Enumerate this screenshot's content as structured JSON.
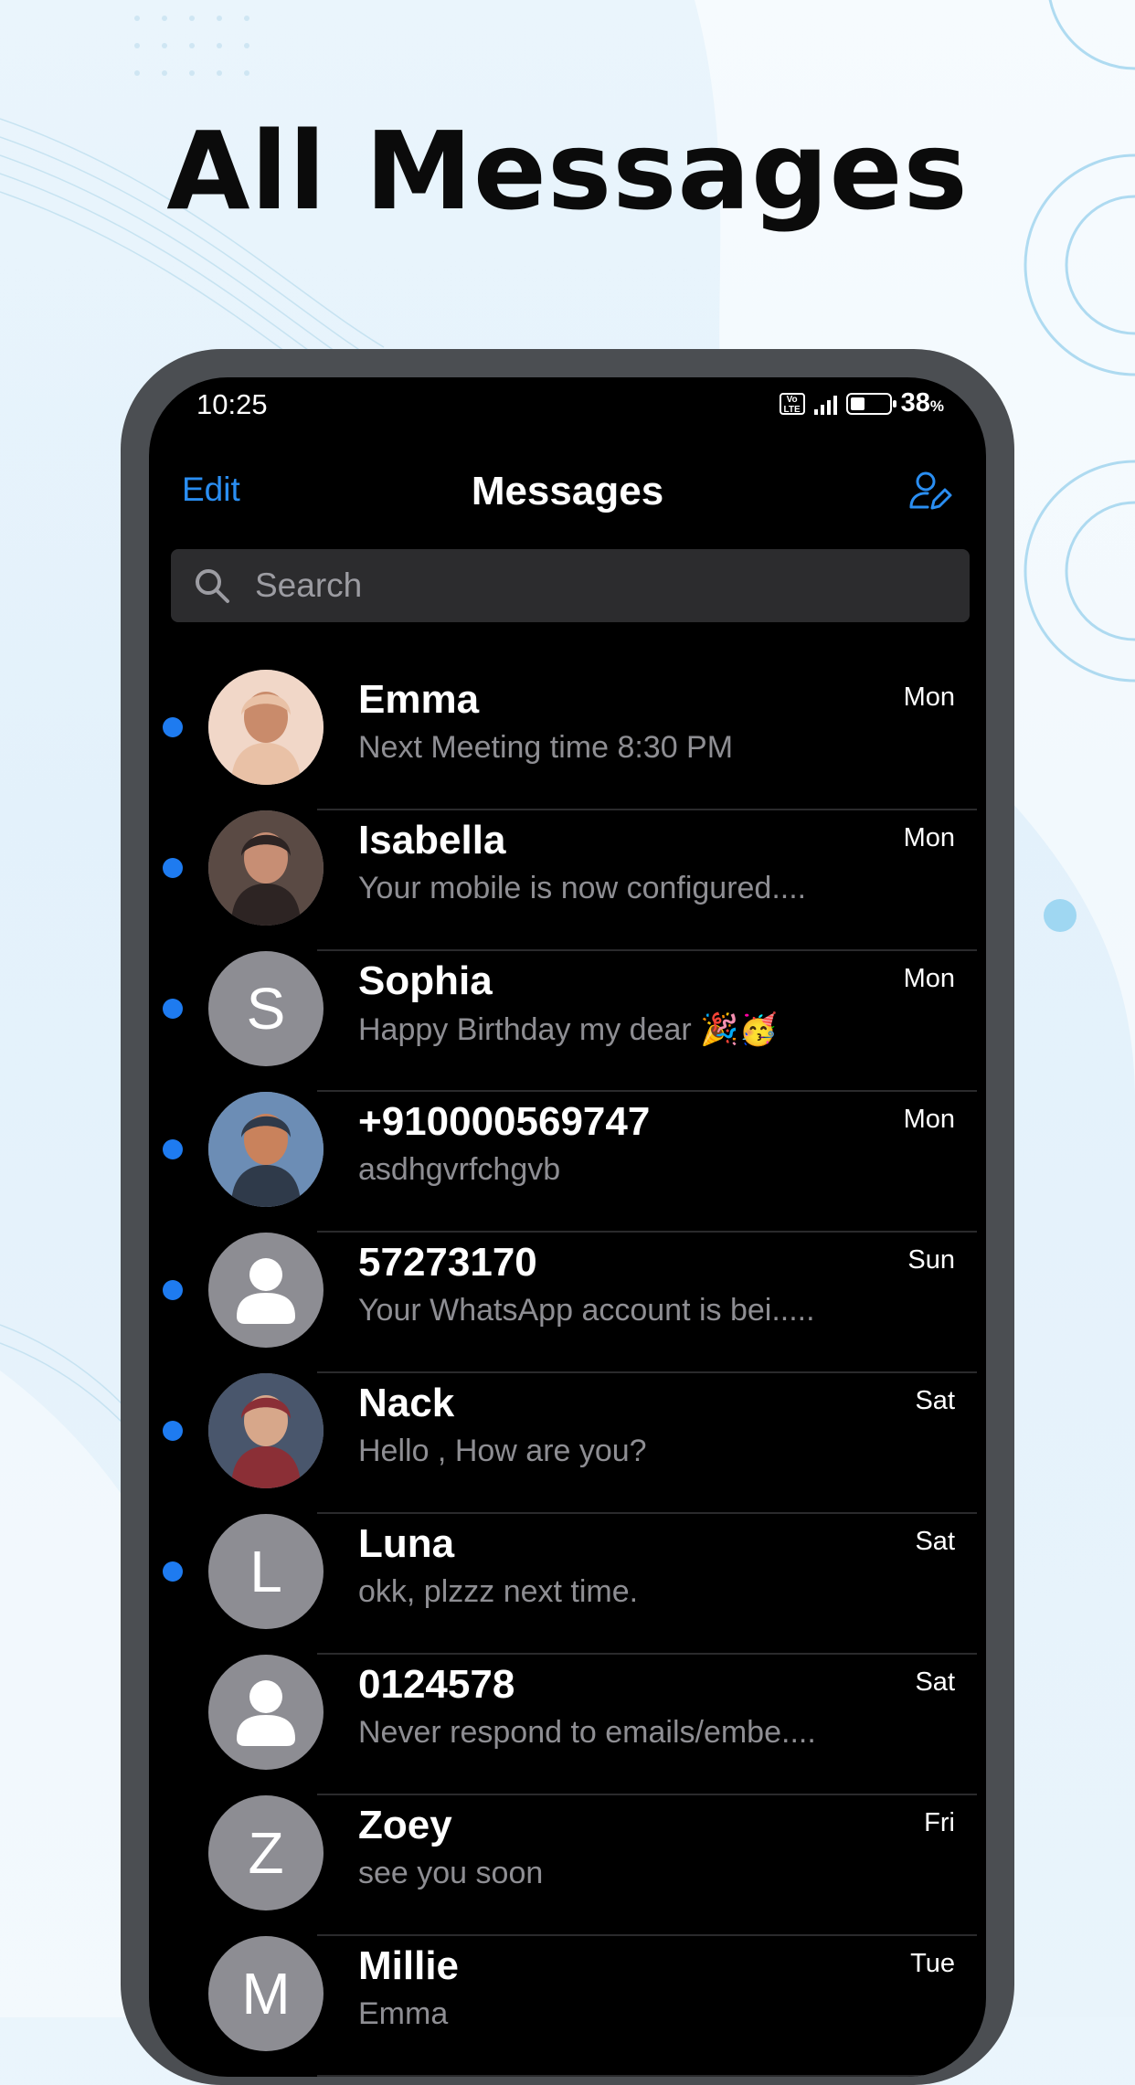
{
  "headline": "All Messages",
  "status_bar": {
    "time": "10:25",
    "volte": "Vo LTE",
    "battery_level": 0.38,
    "battery_value": "38",
    "battery_unit": "%"
  },
  "nav": {
    "edit": "Edit",
    "title": "Messages",
    "compose_icon": "person-edit-icon"
  },
  "search": {
    "icon": "search-icon",
    "placeholder": "Search"
  },
  "colors": {
    "accent": "#2a8ef2",
    "unread_dot": "#1e7bf0",
    "avatar_gray": "#8d8d93"
  },
  "conversations": [
    {
      "name": "Emma",
      "preview": "Next Meeting time 8:30 PM",
      "day": "Mon",
      "unread": true,
      "avatar": "photo"
    },
    {
      "name": "Isabella",
      "preview": "Your mobile is now configured....",
      "day": "Mon",
      "unread": true,
      "avatar": "photo"
    },
    {
      "name": "Sophia",
      "preview": "Happy Birthday my dear 🎉🥳",
      "day": "Mon",
      "unread": true,
      "avatar": "S"
    },
    {
      "name": "+910000569747",
      "preview": "asdhgvrfchgvb",
      "day": "Mon",
      "unread": true,
      "avatar": "photo"
    },
    {
      "name": "57273170",
      "preview": "Your WhatsApp account is bei.....",
      "day": "Sun",
      "unread": true,
      "avatar": "person-icon"
    },
    {
      "name": "Nack",
      "preview": "Hello , How are you?",
      "day": "Sat",
      "unread": true,
      "avatar": "photo"
    },
    {
      "name": "Luna",
      "preview": "okk, plzzz next time.",
      "day": "Sat",
      "unread": true,
      "avatar": "L"
    },
    {
      "name": "0124578",
      "preview": "Never respond to emails/embe....",
      "day": "Sat",
      "unread": false,
      "avatar": "person-icon"
    },
    {
      "name": "Zoey",
      "preview": "see you soon",
      "day": "Fri",
      "unread": false,
      "avatar": "Z"
    },
    {
      "name": "Millie",
      "preview": "Emma",
      "day": "Tue",
      "unread": false,
      "avatar": "M"
    }
  ]
}
